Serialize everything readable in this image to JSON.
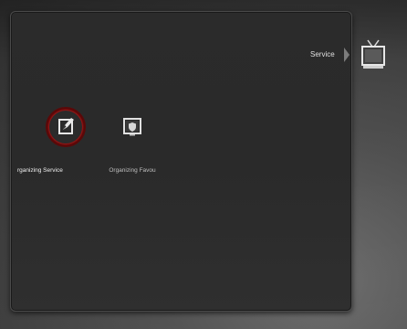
{
  "header": {
    "context_label": "Service",
    "context_icon": "tv-icon"
  },
  "menu": {
    "items": [
      {
        "label": "rganizing Service",
        "icon": "edit-document-icon",
        "selected": true,
        "highlight_color": "#b01c1c"
      },
      {
        "label": "Organizing Favou",
        "icon": "favorite-shield-icon",
        "selected": false
      }
    ]
  },
  "colors": {
    "panel_bg": "#2b2b2b",
    "background": "#4e4e4e",
    "text_primary": "#f0f0f0",
    "text_secondary": "#bfbfbf",
    "selection_ring": "#b01c1c"
  }
}
